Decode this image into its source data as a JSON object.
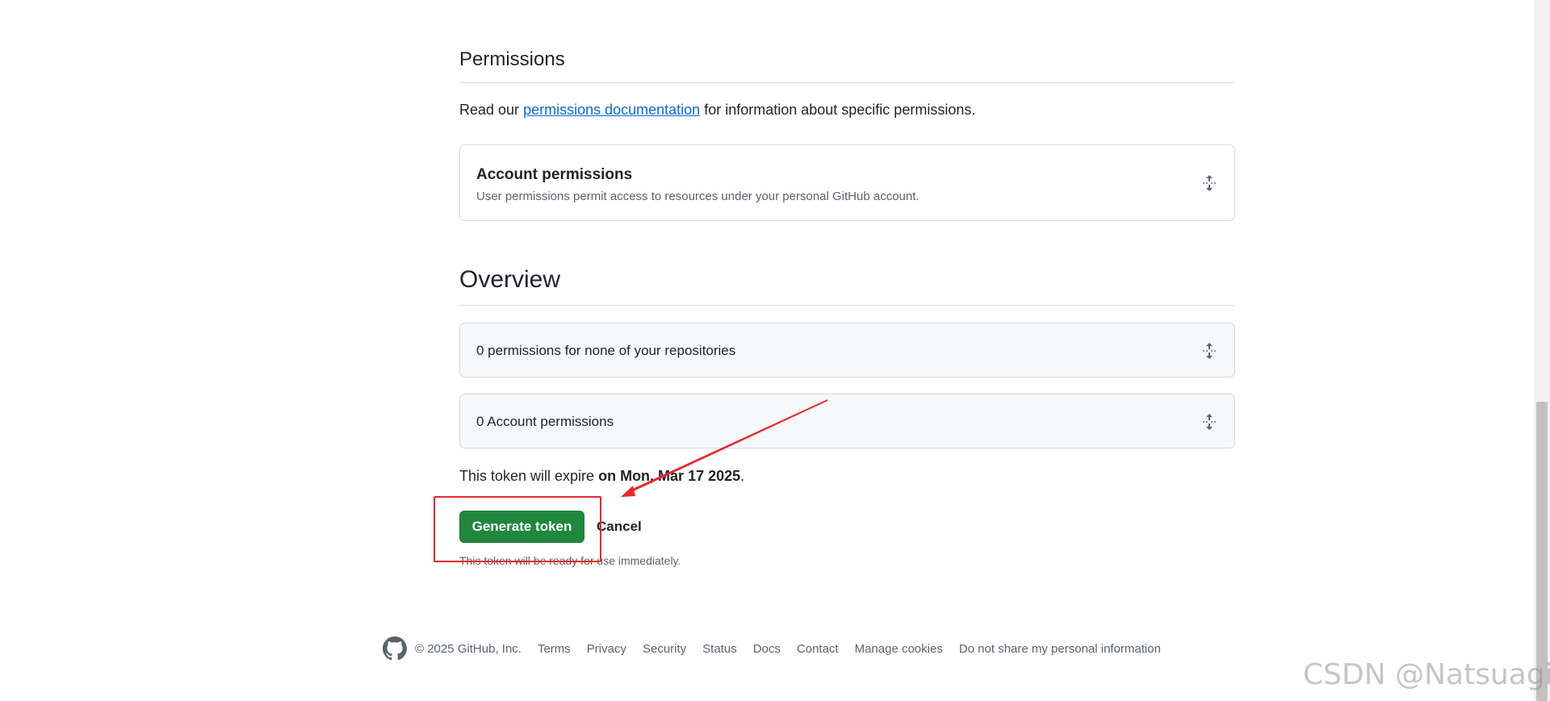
{
  "permissions": {
    "heading": "Permissions",
    "description_before": "Read our ",
    "docs_link": "permissions documentation",
    "description_after": " for information about specific permissions.",
    "account": {
      "title": "Account permissions",
      "subtitle": "User permissions permit access to resources under your personal GitHub account."
    }
  },
  "overview": {
    "heading": "Overview",
    "repo_summary": "0 permissions for none of your repositories",
    "account_summary": "0 Account permissions"
  },
  "expiry": {
    "prefix": "This token will expire ",
    "date": "on Mon, Mar 17 2025",
    "suffix": "."
  },
  "actions": {
    "generate_label": "Generate token",
    "cancel_label": "Cancel",
    "ready_note": "This token will be ready for use immediately."
  },
  "footer": {
    "copyright": "© 2025 GitHub, Inc.",
    "links": [
      "Terms",
      "Privacy",
      "Security",
      "Status",
      "Docs",
      "Contact",
      "Manage cookies",
      "Do not share my personal information"
    ]
  },
  "watermark": "CSDN @Natsuagin",
  "colors": {
    "primary_button": "#1f883d",
    "link": "#0969da",
    "annotation": "#e8272a"
  }
}
